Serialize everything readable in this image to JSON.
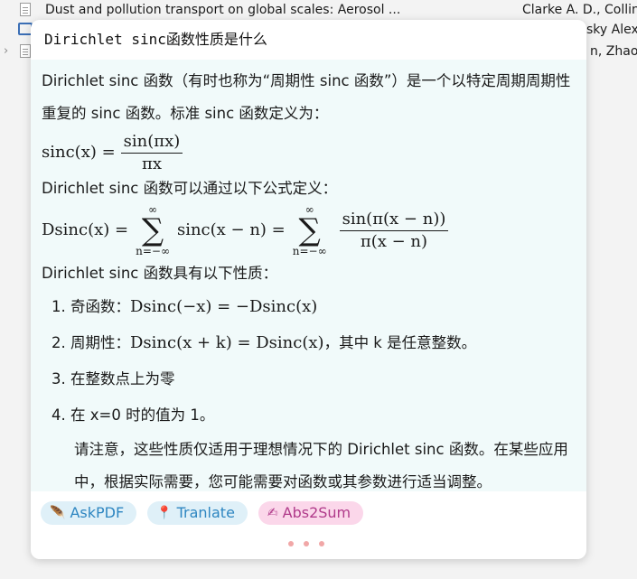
{
  "background_list": {
    "rows": [
      {
        "title": "Dust and pollution transport on global scales: Aerosol ...",
        "creator": "Clarke A. D., Collin"
      },
      {
        "title": "",
        "creator": "sky Alex"
      },
      {
        "title": "",
        "creator": "n, Zhao"
      }
    ]
  },
  "popup": {
    "header": "Dirichlet sinc函数性质是什么",
    "intro_1": "Dirichlet sinc 函数（有时也称为“周期性 sinc 函数”）是一个以特定周期周期性重复的 sinc 函数。标准 sinc 函数定义为：",
    "eq1": {
      "lhs": "sinc(x) =",
      "num": "sin(πx)",
      "den": "πx"
    },
    "intro_2": "Dirichlet sinc 函数可以通过以下公式定义：",
    "eq2": {
      "lhs": "Dsinc(x) =",
      "sum_sup": "∞",
      "sum_sub": "n=−∞",
      "mid": "sinc(x − n) =",
      "num": "sin(π(x − n))",
      "den": "π(x − n)"
    },
    "props_intro": "Dirichlet sinc 函数具有以下性质：",
    "properties": [
      {
        "label": "奇函数：",
        "math": "Dsinc(−x) = −Dsinc(x)",
        "tail": ""
      },
      {
        "label": "周期性：",
        "math": "Dsinc(x + k) = Dsinc(x)",
        "tail": "，其中 k 是任意整数。"
      },
      {
        "label": "在整数点上为零",
        "math": "",
        "tail": ""
      },
      {
        "label": "在 x=0 时的值为 1。",
        "math": "",
        "tail": ""
      }
    ],
    "note": "请注意，这些性质仅适用于理想情况下的 Dirichlet sinc 函数。在某些应用中，根据实际需要，您可能需要对函数或其参数进行适当调整。",
    "buttons": {
      "ask": "AskPDF",
      "translate": "Tranlate",
      "abs": "Abs2Sum"
    },
    "icons": {
      "ask": "feather-icon",
      "translate": "pin-icon",
      "abs": "writing-hand-icon"
    }
  }
}
